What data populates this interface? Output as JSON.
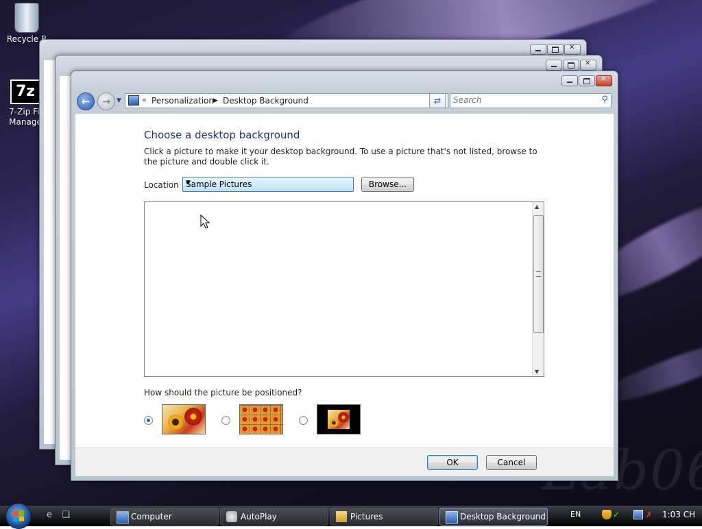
{
  "desktop": {
    "icons": [
      {
        "label": "Recycle B"
      },
      {
        "label": "7-Zip Fil Manage"
      }
    ],
    "watermark": "Lab06"
  },
  "window": {
    "breadcrumb": {
      "root": "Personalization",
      "current": "Desktop Background"
    },
    "search": {
      "placeholder": "Search"
    },
    "title": "Choose a desktop background",
    "description": "Click a picture to make it your desktop background. To use a picture that's not listed, browse to the picture and double click it.",
    "location": {
      "label": "Location",
      "value": "Sample Pictures"
    },
    "browse_label": "Browse...",
    "position_question": "How should the picture be positioned?",
    "position_options": [
      {
        "name": "fit-to-screen",
        "selected": true
      },
      {
        "name": "tile",
        "selected": false
      },
      {
        "name": "center",
        "selected": false
      }
    ],
    "ok_label": "OK",
    "cancel_label": "Cancel"
  },
  "taskbar": {
    "tasks": [
      {
        "label": "Computer",
        "icon": "computer-icon",
        "active": false
      },
      {
        "label": "AutoPlay",
        "icon": "autoplay-icon",
        "active": false
      },
      {
        "label": "Pictures",
        "icon": "folder-icon",
        "active": false
      },
      {
        "label": "Desktop Background",
        "icon": "display-icon",
        "active": true
      }
    ],
    "language": "EN",
    "clock": "1:03 CH"
  },
  "colors": {
    "title_blue": "#1e3287",
    "accent": "#3c7fb1",
    "taskbar": "#202328"
  }
}
